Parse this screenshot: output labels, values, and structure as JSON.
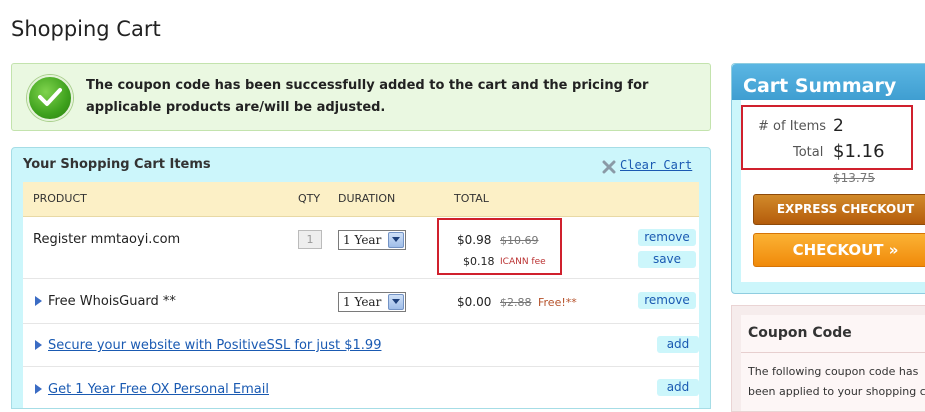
{
  "page": {
    "title": "Shopping Cart"
  },
  "banner": {
    "message": "The coupon code has been successfully added to the cart and the pricing for applicable products are/will be adjusted."
  },
  "cart": {
    "title": "Your Shopping Cart Items",
    "clear_label": "Clear Cart",
    "columns": {
      "product": "PRODUCT",
      "qty": "QTY",
      "duration": "DURATION",
      "total": "TOTAL"
    },
    "rows": [
      {
        "product": "Register mmtaoyi.com",
        "qty": "1",
        "duration": "1 Year",
        "price": "$0.98",
        "old_price": "$10.69",
        "fee_price": "$0.18",
        "fee_label": "ICANN fee",
        "actions": [
          "remove",
          "save"
        ]
      },
      {
        "product": "Free WhoisGuard **",
        "duration": "1 Year",
        "price": "$0.00",
        "old_price": "$2.88",
        "free_label": "Free!**",
        "actions": [
          "remove"
        ]
      }
    ],
    "upsells": [
      {
        "label": "Secure your website with PositiveSSL for just $1.99",
        "action": "add"
      },
      {
        "label": "Get 1 Year Free OX Personal Email",
        "action": "add"
      }
    ]
  },
  "summary": {
    "title": "Cart Summary",
    "items_label": "# of Items",
    "items_value": "2",
    "total_label": "Total",
    "total_value": "$1.16",
    "old_total": "$13.75",
    "express_checkout": "EXPRESS CHECKOUT",
    "checkout": "CHECKOUT »"
  },
  "coupon": {
    "title": "Coupon Code",
    "text_line1": "The following coupon code has",
    "text_line2": "been applied to your shopping ca"
  },
  "colors": {
    "accent_blue": "#3f9ed1",
    "link": "#1a5ab2",
    "highlight_red": "#d0202d",
    "checkout_orange": "#f08a0a"
  }
}
